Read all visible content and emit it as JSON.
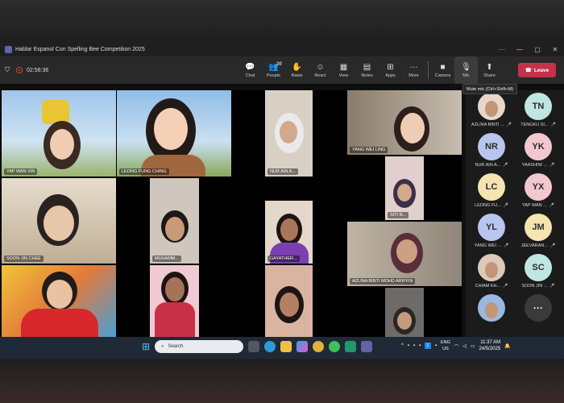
{
  "window": {
    "title": "Hablar Espanol Con Spelling Bee Competition 2025"
  },
  "meeting": {
    "timer": "02:56:36"
  },
  "toolbar": {
    "items": [
      {
        "label": "Chat",
        "icon": "chat-icon",
        "glyph": "💬"
      },
      {
        "label": "People",
        "icon": "people-icon",
        "glyph": "👥",
        "count": "30"
      },
      {
        "label": "Raise",
        "icon": "raise-hand-icon",
        "glyph": "✋"
      },
      {
        "label": "React",
        "icon": "react-icon",
        "glyph": "☺"
      },
      {
        "label": "View",
        "icon": "view-icon",
        "glyph": "▦"
      },
      {
        "label": "Notes",
        "icon": "notes-icon",
        "glyph": "▤"
      },
      {
        "label": "Apps",
        "icon": "apps-icon",
        "glyph": "⊞"
      },
      {
        "label": "More",
        "icon": "more-icon",
        "glyph": "···"
      }
    ],
    "camera": "Camera",
    "mic": "Mic",
    "share": "Share",
    "leave": "Leave",
    "mic_tooltip": "Mute mic (Ctrl+Shift+M)"
  },
  "tiles": [
    {
      "name": "YAP WAN XIN"
    },
    {
      "name": "LEONG FUNG CHING"
    },
    {
      "name": "NUR AIN A..."
    },
    {
      "name": "YANG WEI LING"
    },
    {
      "name": "SOON JIN CHEE"
    },
    {
      "name": "MUHAMM..."
    },
    {
      "name": "SITI N..."
    },
    {
      "name": "GAYATHER..."
    },
    {
      "name": "AZLINA BINTI MOHD ARIFFIN"
    }
  ],
  "panel": [
    {
      "initials": "",
      "name": "AZLINA BINTI ...",
      "photo": true
    },
    {
      "initials": "TN",
      "name": "TENGKU SI..."
    },
    {
      "initials": "NR",
      "name": "NUR AIN A..."
    },
    {
      "initials": "YK",
      "name": "YAASHINI ..."
    },
    {
      "initials": "LC",
      "name": "LEONG FU..."
    },
    {
      "initials": "YX",
      "name": "YAP WAN ..."
    },
    {
      "initials": "YL",
      "name": "YANG WEI ..."
    },
    {
      "initials": "JM",
      "name": "JEEVARAN..."
    },
    {
      "initials": "",
      "name": "CHIAM KH...",
      "photo": true
    },
    {
      "initials": "SC",
      "name": "SOON JIN ..."
    },
    {
      "initials": "",
      "name": "",
      "photo": true
    },
    {
      "initials": "···",
      "name": ""
    }
  ],
  "taskbar": {
    "search": "Search",
    "lang1": "ENG",
    "lang2": "US",
    "time": "11:37 AM",
    "date": "24/5/2025"
  },
  "colors": {
    "leave": "#c4314b",
    "panel_bg": "#1b1b1b",
    "avatar_blue": "#b8c6ef",
    "avatar_pink": "#f3c7cf",
    "avatar_yellow": "#f5e3b0",
    "avatar_teal": "#bfe6e2"
  }
}
